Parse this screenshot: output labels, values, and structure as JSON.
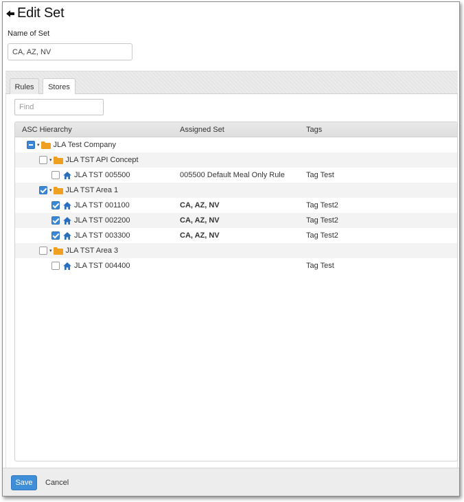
{
  "page": {
    "title": "Edit Set"
  },
  "form": {
    "name_label": "Name of Set",
    "name_value": "CA, AZ, NV"
  },
  "tabs": [
    {
      "label": "Rules"
    },
    {
      "label": "Stores"
    }
  ],
  "find": {
    "placeholder": "Find"
  },
  "grid": {
    "columns": [
      "ASC Hierarchy",
      "Assigned Set",
      "Tags"
    ],
    "rows": [
      {
        "label": "JLA Test Company",
        "type": "folder",
        "checkbox": "partial",
        "assigned": "",
        "tags": ""
      },
      {
        "label": "JLA TST API Concept",
        "type": "folder",
        "checkbox": "unchecked",
        "assigned": "",
        "tags": ""
      },
      {
        "label": "JLA TST 005500",
        "type": "store",
        "checkbox": "unchecked",
        "assigned": "005500 Default Meal Only Rule",
        "tags": "Tag Test"
      },
      {
        "label": "JLA TST Area 1",
        "type": "folder",
        "checkbox": "checked",
        "assigned": "",
        "tags": ""
      },
      {
        "label": "JLA TST 001100",
        "type": "store",
        "checkbox": "checked",
        "assigned": "CA, AZ, NV",
        "tags": "Tag Test2"
      },
      {
        "label": "JLA TST 002200",
        "type": "store",
        "checkbox": "checked",
        "assigned": "CA, AZ, NV",
        "tags": "Tag Test2"
      },
      {
        "label": "JLA TST 003300",
        "type": "store",
        "checkbox": "checked",
        "assigned": "CA, AZ, NV",
        "tags": "Tag Test2"
      },
      {
        "label": "JLA TST Area 3",
        "type": "folder",
        "checkbox": "unchecked",
        "assigned": "",
        "tags": ""
      },
      {
        "label": "JLA TST 004400",
        "type": "store",
        "checkbox": "unchecked",
        "assigned": "",
        "tags": "Tag Test"
      }
    ]
  },
  "footer": {
    "save_label": "Save",
    "cancel_label": "Cancel"
  },
  "icons": {
    "back": "arrow-left-icon",
    "folder": "folder-icon",
    "store": "home-icon",
    "caret": "caret-down-icon"
  },
  "colors": {
    "accent": "#3f8fd8",
    "folder": "#f0a020",
    "store_icon": "#2a6fbf"
  }
}
